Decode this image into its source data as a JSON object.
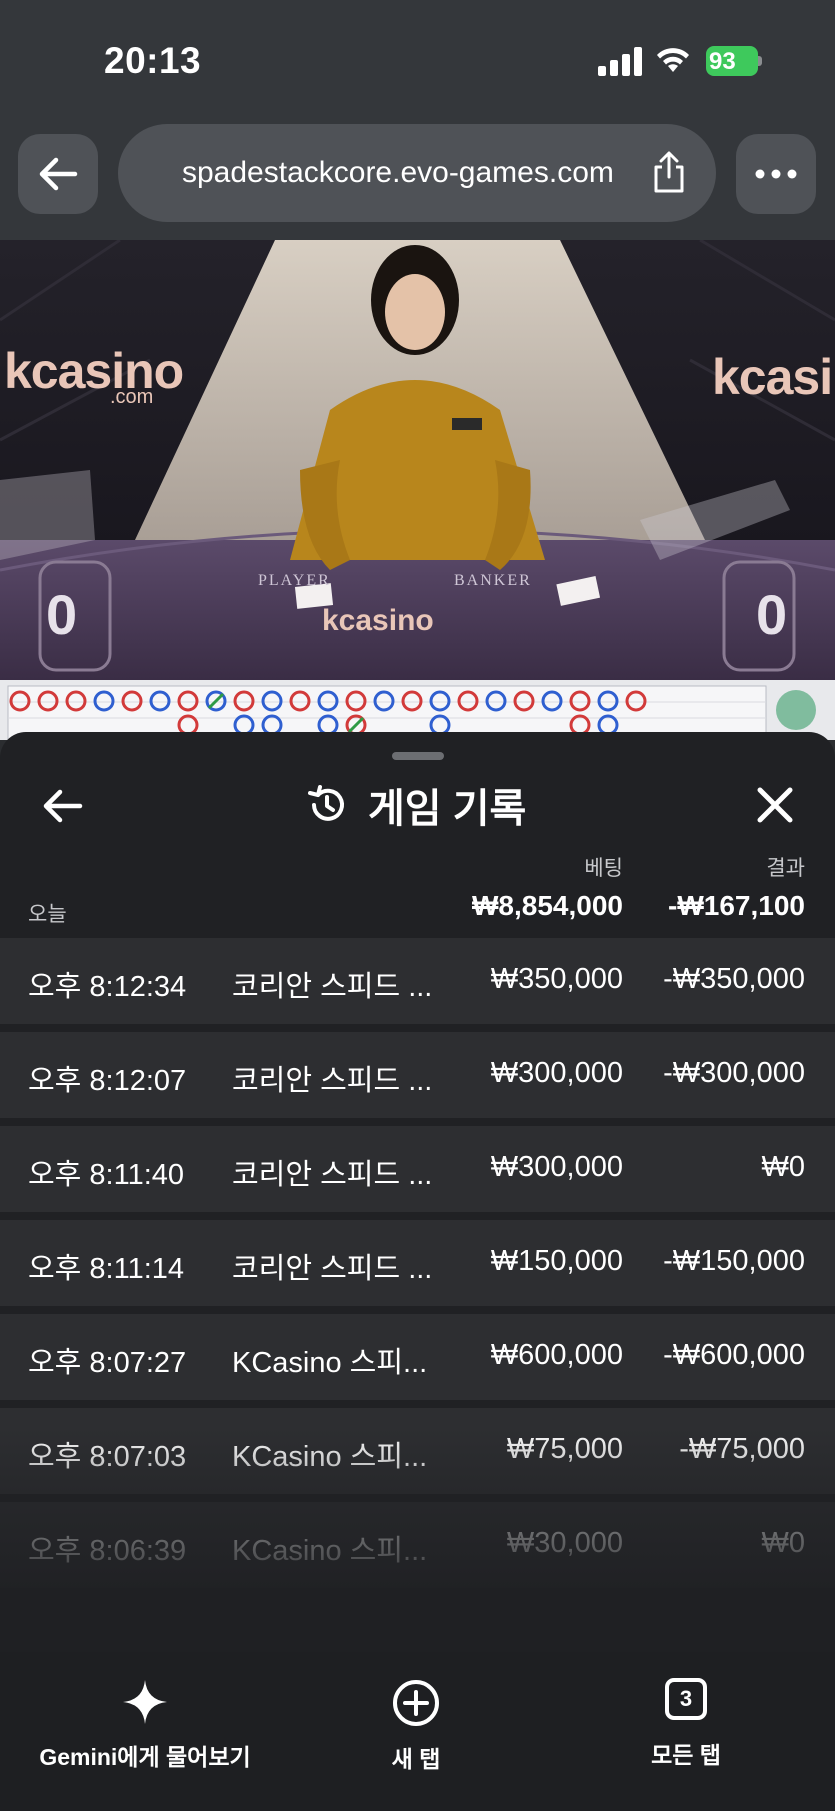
{
  "status_bar": {
    "time": "20:13",
    "battery": "93"
  },
  "browser": {
    "url": "spadestackcore.evo-games.com"
  },
  "video": {
    "brand": "kcasino",
    "brand_sub": ".com",
    "player_label": "PLAYER",
    "banker_label": "BANKER",
    "player_score": "0",
    "banker_score": "0"
  },
  "sheet": {
    "title": "게임 기록",
    "col_bet": "베팅",
    "col_result": "결과",
    "today_label": "오늘",
    "total_bet": "₩8,854,000",
    "total_result": "-₩167,100",
    "rows": [
      {
        "time": "오후 8:12:34",
        "game": "코리안 스피드 ...",
        "bet": "₩350,000",
        "result": "-₩350,000"
      },
      {
        "time": "오후 8:12:07",
        "game": "코리안 스피드 ...",
        "bet": "₩300,000",
        "result": "-₩300,000"
      },
      {
        "time": "오후 8:11:40",
        "game": "코리안 스피드 ...",
        "bet": "₩300,000",
        "result": "₩0"
      },
      {
        "time": "오후 8:11:14",
        "game": "코리안 스피드 ...",
        "bet": "₩150,000",
        "result": "-₩150,000"
      },
      {
        "time": "오후 8:07:27",
        "game": "KCasino 스피...",
        "bet": "₩600,000",
        "result": "-₩600,000"
      },
      {
        "time": "오후 8:07:03",
        "game": "KCasino 스피...",
        "bet": "₩75,000",
        "result": "-₩75,000"
      },
      {
        "time": "오후 8:06:39",
        "game": "KCasino 스피...",
        "bet": "₩30,000",
        "result": "₩0"
      }
    ]
  },
  "toolbar": {
    "gemini_label": "Gemini에게 물어보기",
    "new_tab_label": "새 탭",
    "all_tabs_label": "모든 탭",
    "tab_count": "3"
  },
  "icons": {
    "back": "arrow-left-icon",
    "share": "share-icon",
    "more": "more-dots-icon",
    "history": "history-icon",
    "close": "close-icon",
    "gemini": "sparkle-icon",
    "new_tab": "plus-circle-icon",
    "tabs": "tabs-icon"
  },
  "colors": {
    "battery": "#3ec95c",
    "sheet_bg": "#202124",
    "row_bg": "#2d2e31",
    "road_red": "#d23a3a",
    "road_blue": "#2f5fd0"
  }
}
